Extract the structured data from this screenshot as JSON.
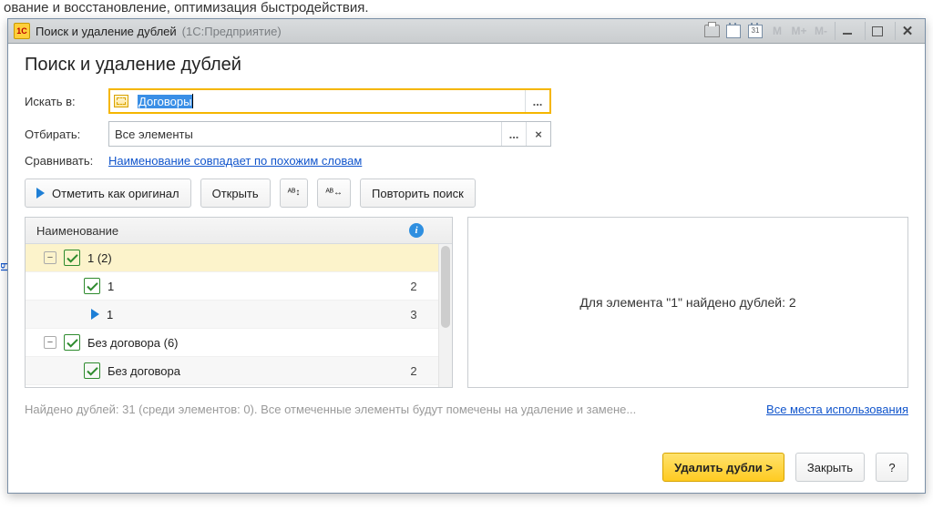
{
  "bg_line": "ование и восстановление, оптимизация быстродействия.",
  "bg_link": "ы",
  "titlebar": {
    "title": "Поиск и удаление дублей",
    "sub": "(1С:Предприятие)",
    "cal_day": "31",
    "m": "М",
    "m_plus": "М+",
    "m_minus": "М-"
  },
  "page_title": "Поиск и удаление дублей",
  "labels": {
    "search_in": "Искать в:",
    "filter": "Отбирать:",
    "compare": "Сравнивать:"
  },
  "fields": {
    "search_in": "Договоры",
    "filter": "Все элементы",
    "compare_link": "Наименование совпадает по похожим словам",
    "ellipsis": "...",
    "clear": "×"
  },
  "toolbar": {
    "mark_original": "Отметить как оригинал",
    "open": "Открыть",
    "repeat_search": "Повторить поиск",
    "icon1": "ᴬᴮ↕",
    "icon2": "ᴬᴮ↔"
  },
  "grid": {
    "col_name": "Наименование",
    "rows": [
      {
        "type": "group",
        "toggle": "⊝",
        "checked": true,
        "label": "1 (2)",
        "num": "",
        "sel": true
      },
      {
        "type": "item",
        "checked": true,
        "label": "1",
        "num": "2"
      },
      {
        "type": "orig",
        "label": "1",
        "num": "3"
      },
      {
        "type": "group",
        "toggle": "⊝",
        "checked": true,
        "label": "Без договора (6)",
        "num": ""
      },
      {
        "type": "item",
        "checked": true,
        "label": "Без договора",
        "num": "2"
      }
    ]
  },
  "right_panel_msg": "Для элемента \"1\" найдено дублей: 2",
  "status_text": "Найдено дублей: 31 (среди элементов: 0). Все отмеченные элементы будут помечены на удаление и замене...",
  "status_link": "Все места использования",
  "footer": {
    "delete": "Удалить дубли >",
    "close": "Закрыть",
    "help": "?"
  }
}
